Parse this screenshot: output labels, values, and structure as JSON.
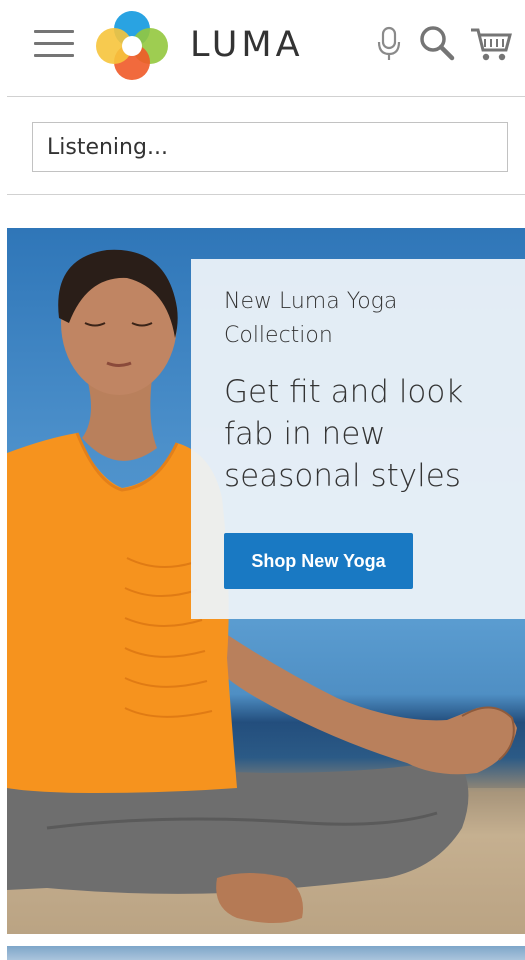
{
  "header": {
    "logo_text": "LUMA",
    "icons": [
      "menu-icon",
      "mic-icon",
      "search-icon",
      "cart-icon"
    ]
  },
  "search": {
    "value": "Listening..."
  },
  "hero": {
    "subtitle": "New Luma Yoga Collection",
    "title": "Get fit and look fab in new seasonal styles",
    "button_label": "Shop New Yoga"
  },
  "colors": {
    "accent": "#1979c3",
    "divider": "#d1d1d1"
  }
}
